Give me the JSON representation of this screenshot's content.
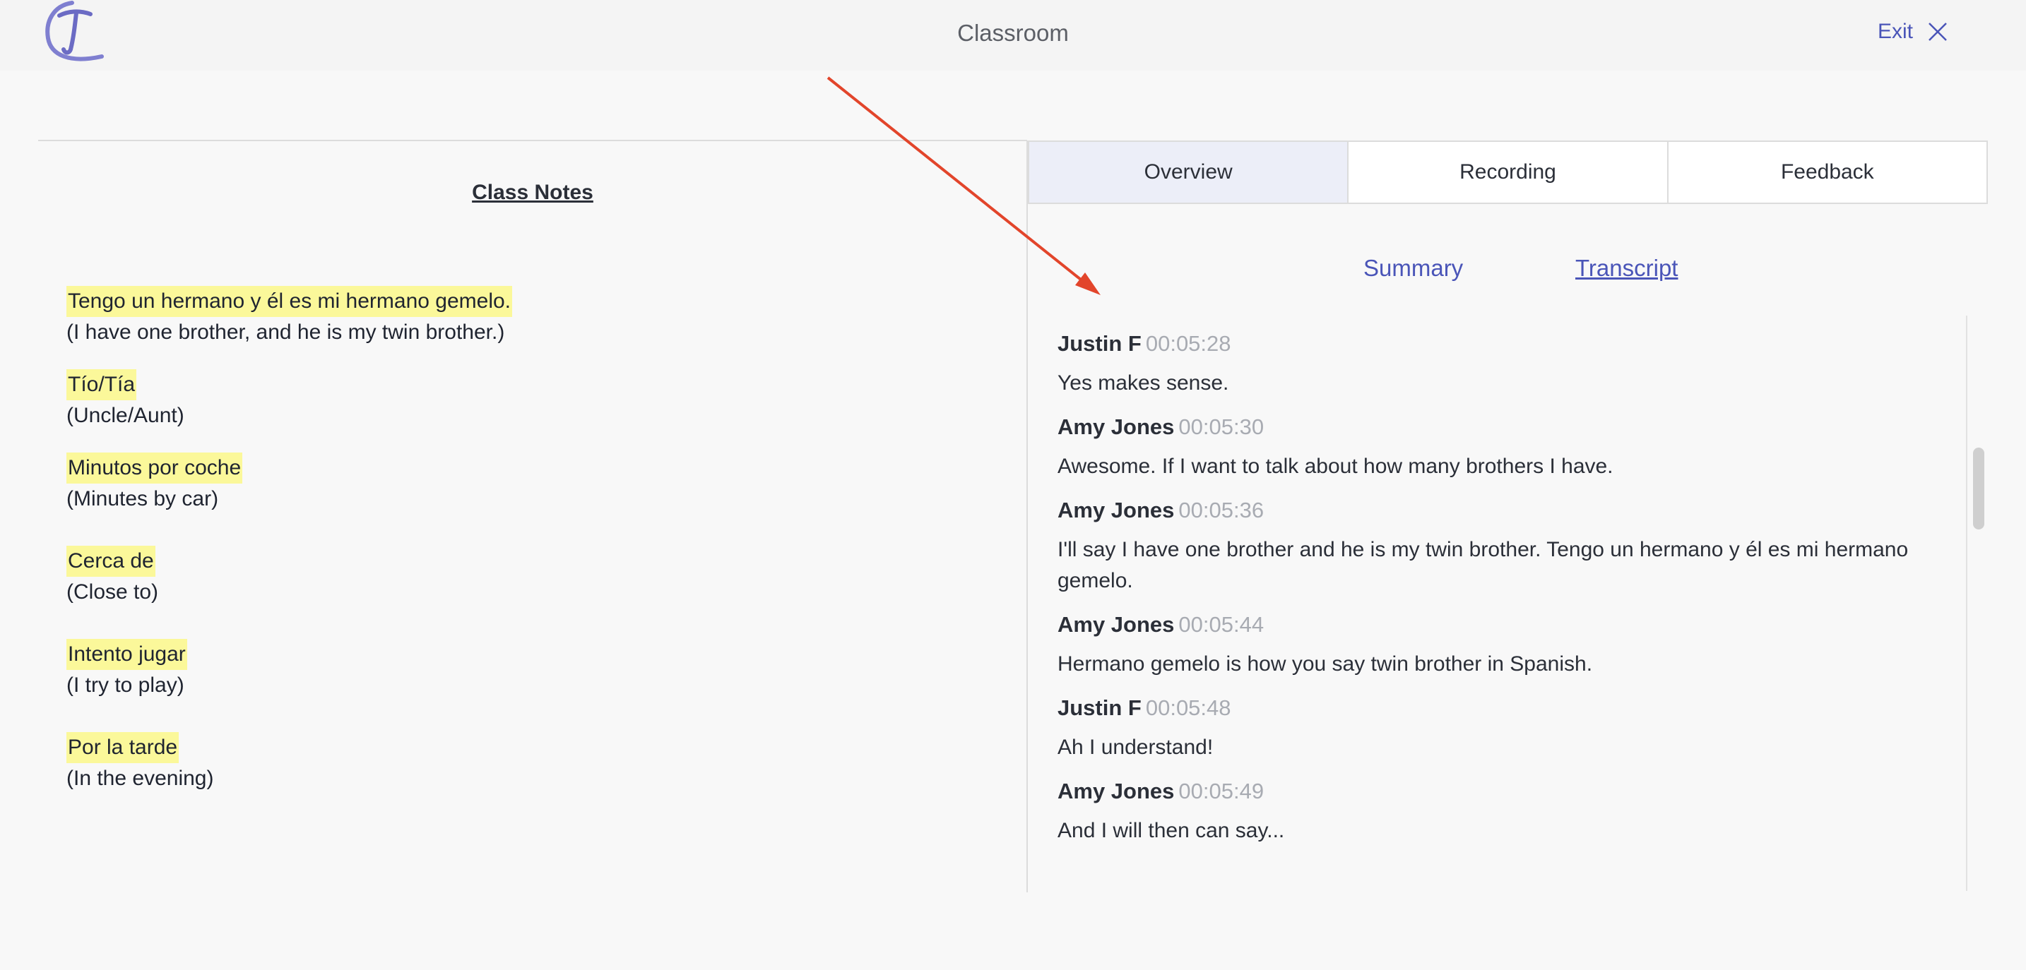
{
  "header": {
    "title": "Classroom",
    "exit_label": "Exit"
  },
  "notes": {
    "title": "Class Notes",
    "items": [
      {
        "es": "Tengo un hermano y él es mi hermano gemelo.",
        "en": "(I have one brother, and he is my twin brother.)"
      },
      {
        "es": "Tío/Tía",
        "en": "(Uncle/Aunt)"
      },
      {
        "es": "Minutos por coche",
        "en": "(Minutes by car)"
      },
      {
        "es": "Cerca de",
        "en": "(Close to)"
      },
      {
        "es": "Intento jugar",
        "en": "(I try to play)"
      },
      {
        "es": "Por la tarde",
        "en": "(In the evening)"
      }
    ]
  },
  "tabs": [
    {
      "label": "Overview",
      "active": true
    },
    {
      "label": "Recording",
      "active": false
    },
    {
      "label": "Feedback",
      "active": false
    }
  ],
  "subtabs": {
    "summary": "Summary",
    "transcript": "Transcript"
  },
  "transcript": [
    {
      "speaker": "Justin F",
      "time": "00:05:28",
      "text": "Yes makes sense."
    },
    {
      "speaker": "Amy Jones",
      "time": "00:05:30",
      "text": "Awesome. If I want to talk about how many brothers I have."
    },
    {
      "speaker": "Amy Jones",
      "time": "00:05:36",
      "text": "I'll say I have one brother and he is my twin brother. Tengo un hermano y él es mi hermano gemelo."
    },
    {
      "speaker": "Amy Jones",
      "time": "00:05:44",
      "text": "Hermano gemelo is how you say twin brother in Spanish."
    },
    {
      "speaker": "Justin F",
      "time": "00:05:48",
      "text": "Ah I understand!"
    },
    {
      "speaker": "Amy Jones",
      "time": "00:05:49",
      "text": "And I will then can say..."
    }
  ],
  "colors": {
    "accent": "#4a55b8",
    "highlight": "#fbf89a",
    "annotation_arrow": "#e2452b"
  }
}
